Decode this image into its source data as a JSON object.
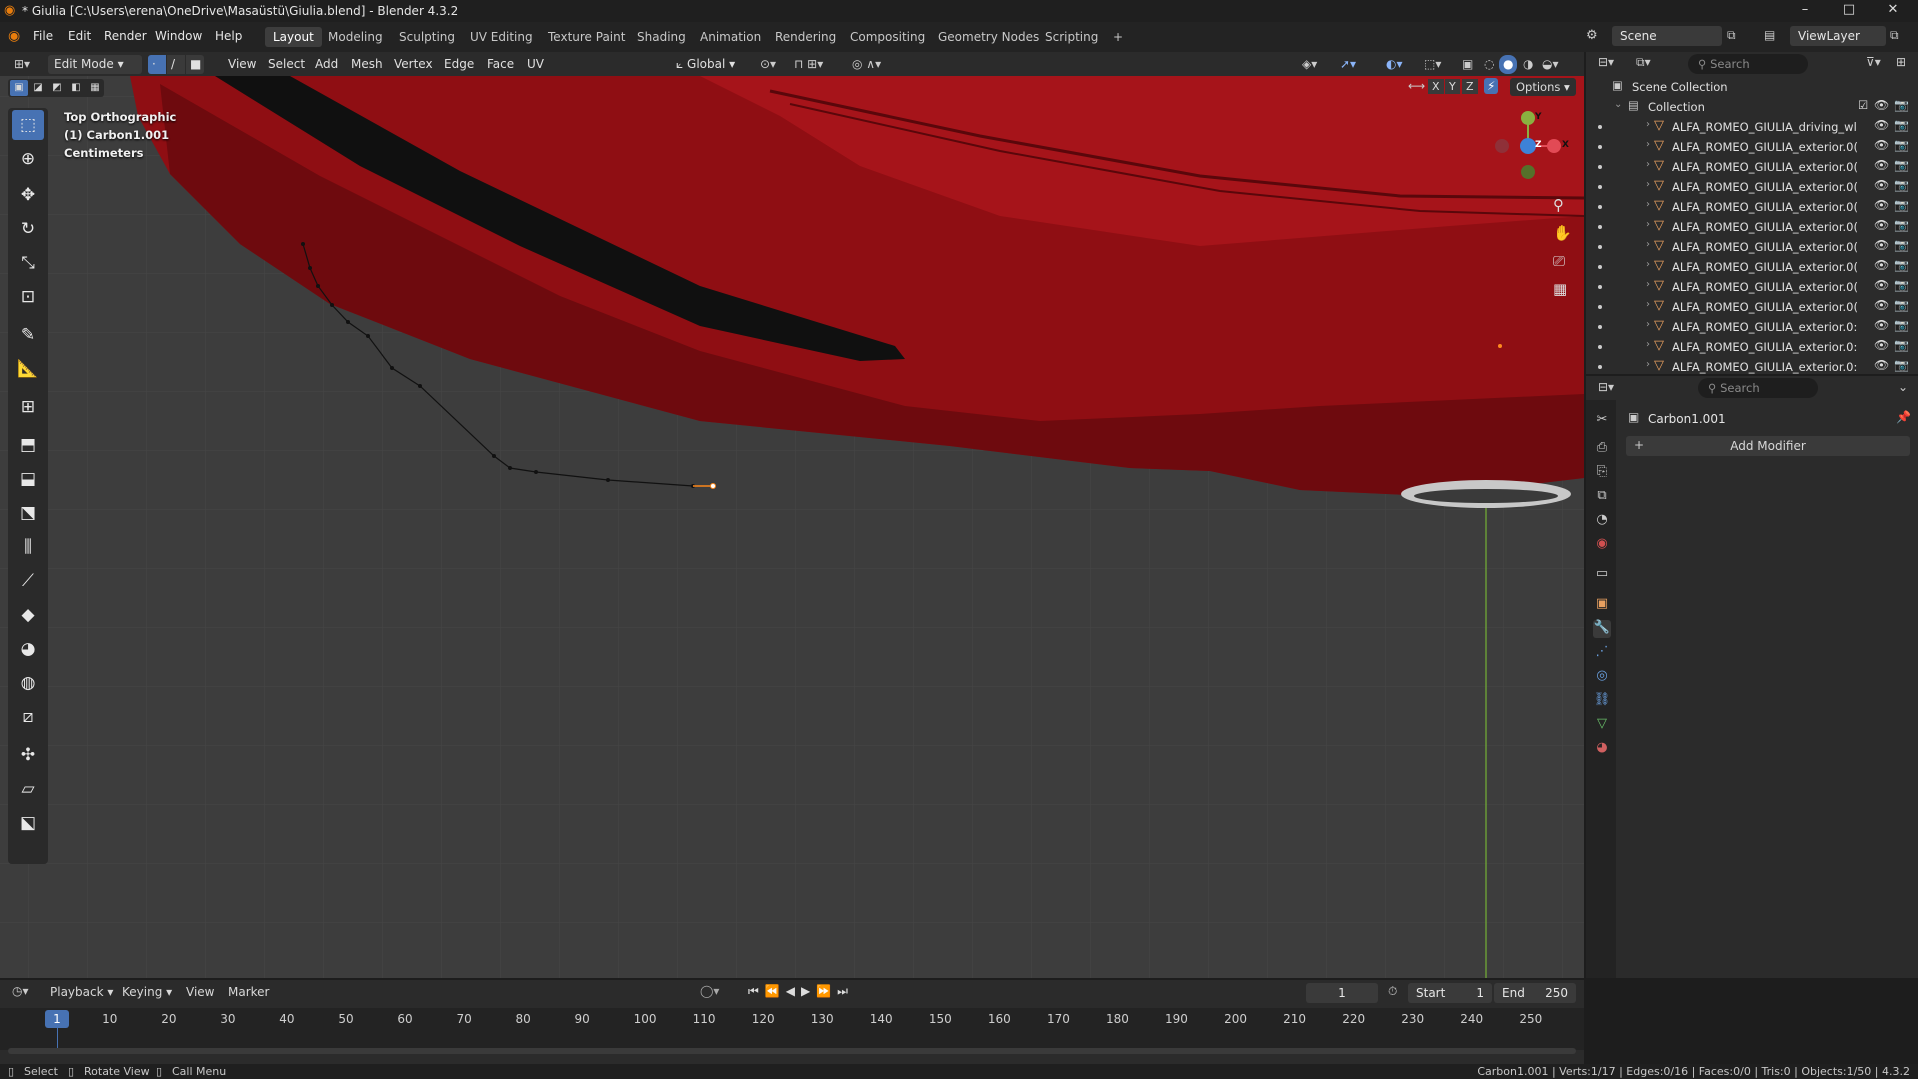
{
  "titlebar": {
    "title": "* Giulia [C:\\Users\\erena\\OneDrive\\Masaüstü\\Giulia.blend] - Blender 4.3.2",
    "minimize": "–",
    "maximize": "□",
    "close": "✕"
  },
  "menubar": {
    "menus": [
      "File",
      "Edit",
      "Render",
      "Window",
      "Help"
    ],
    "workspaces": [
      "Layout",
      "Modeling",
      "Sculpting",
      "UV Editing",
      "Texture Paint",
      "Shading",
      "Animation",
      "Rendering",
      "Compositing",
      "Geometry Nodes",
      "Scripting"
    ],
    "active_workspace": "Layout",
    "add_workspace": "+",
    "scene_label": "Scene",
    "viewlayer_label": "ViewLayer"
  },
  "viewport_header": {
    "mode": "Edit Mode",
    "menus": [
      "View",
      "Select",
      "Add",
      "Mesh",
      "Vertex",
      "Edge",
      "Face",
      "UV"
    ],
    "orientation": "Global",
    "options": "Options",
    "axes": [
      "X",
      "Y",
      "Z"
    ]
  },
  "viewport": {
    "view_name": "Top Orthographic",
    "object_info": "(1) Carbon1.001",
    "units": "Centimeters",
    "gizmo": {
      "y": "Y",
      "x": "X",
      "z": "Z"
    }
  },
  "outliner": {
    "search_placeholder": "Search",
    "scene_collection": "Scene Collection",
    "collection": "Collection",
    "items": [
      "ALFA_ROMEO_GIULIA_driving_wl",
      "ALFA_ROMEO_GIULIA_exterior.0(",
      "ALFA_ROMEO_GIULIA_exterior.0(",
      "ALFA_ROMEO_GIULIA_exterior.0(",
      "ALFA_ROMEO_GIULIA_exterior.0(",
      "ALFA_ROMEO_GIULIA_exterior.0(",
      "ALFA_ROMEO_GIULIA_exterior.0(",
      "ALFA_ROMEO_GIULIA_exterior.0(",
      "ALFA_ROMEO_GIULIA_exterior.0(",
      "ALFA_ROMEO_GIULIA_exterior.0(",
      "ALFA_ROMEO_GIULIA_exterior.0:",
      "ALFA_ROMEO_GIULIA_exterior.0:",
      "ALFA_ROMEO_GIULIA_exterior.0:"
    ]
  },
  "properties": {
    "search_placeholder": "Search",
    "object_name": "Carbon1.001",
    "add_modifier": "Add Modifier"
  },
  "timeline": {
    "menus": [
      "Playback",
      "Keying",
      "View",
      "Marker"
    ],
    "current_frame": "1",
    "start_label": "Start",
    "start": "1",
    "end_label": "End",
    "end": "250",
    "ticks": [
      "1",
      "10",
      "20",
      "30",
      "40",
      "50",
      "60",
      "70",
      "80",
      "90",
      "100",
      "110",
      "120",
      "130",
      "140",
      "150",
      "160",
      "170",
      "180",
      "190",
      "200",
      "210",
      "220",
      "230",
      "240",
      "250"
    ]
  },
  "statusbar": {
    "select": "Select",
    "rotate": "Rotate View",
    "call_menu": "Call Menu",
    "stats": "Carbon1.001 | Verts:1/17 | Edges:0/16 | Faces:0/0 | Tris:0 | Objects:1/50 | 4.3.2"
  },
  "colors": {
    "accent": "#4772b3",
    "car_red": "#9a0f14",
    "grid_bg": "#3d3d3d"
  }
}
